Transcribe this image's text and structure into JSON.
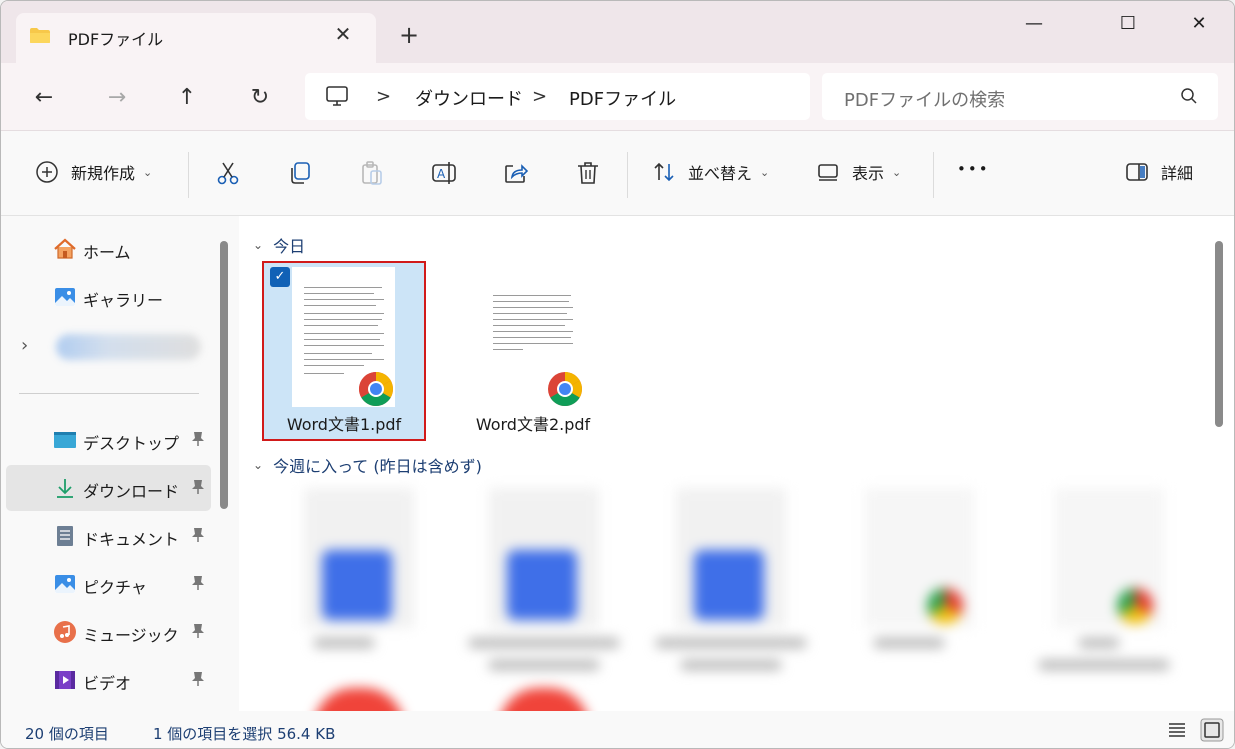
{
  "window": {
    "tab_title": "PDFファイル",
    "tab_close": "✕",
    "new_tab": "+",
    "minimize": "—",
    "maximize": "☐",
    "close": "✕"
  },
  "nav": {
    "back": "←",
    "forward": "→",
    "up": "↑",
    "refresh": "↻",
    "breadcrumb": [
      "ダウンロード",
      "PDFファイル"
    ],
    "separator": ">",
    "search_placeholder": "PDFファイルの検索"
  },
  "toolbar": {
    "new_label": "新規作成",
    "sort_label": "並べ替え",
    "view_label": "表示",
    "more_label": "•••",
    "details_label": "詳細",
    "chevron": "⌄"
  },
  "sidebar": {
    "items": [
      {
        "label": "ホーム",
        "icon": "home-icon"
      },
      {
        "label": "ギャラリー",
        "icon": "gallery-icon"
      },
      {
        "label": "デスクトップ",
        "icon": "desktop-icon",
        "pinned": true
      },
      {
        "label": "ダウンロード",
        "icon": "download-icon",
        "pinned": true,
        "selected": true
      },
      {
        "label": "ドキュメント",
        "icon": "document-icon",
        "pinned": true
      },
      {
        "label": "ピクチャ",
        "icon": "pictures-icon",
        "pinned": true
      },
      {
        "label": "ミュージック",
        "icon": "music-icon",
        "pinned": true
      },
      {
        "label": "ビデオ",
        "icon": "video-icon",
        "pinned": true
      }
    ],
    "expander": "›"
  },
  "content": {
    "groups": [
      {
        "title": "今日",
        "files": [
          {
            "name": "Word文書1.pdf",
            "selected": true
          },
          {
            "name": "Word文書2.pdf",
            "selected": false
          }
        ]
      },
      {
        "title": "今週に入って (昨日は含めず)"
      }
    ],
    "group_chevron": "⌄",
    "check_mark": "✓"
  },
  "status": {
    "item_count": "20 個の項目",
    "selection": "1 個の項目を選択  56.4 KB"
  },
  "colors": {
    "accent": "#1061b6",
    "selection_bg": "#cce4f7",
    "highlight_border": "#d11a1a",
    "group_header": "#1d3f73"
  }
}
